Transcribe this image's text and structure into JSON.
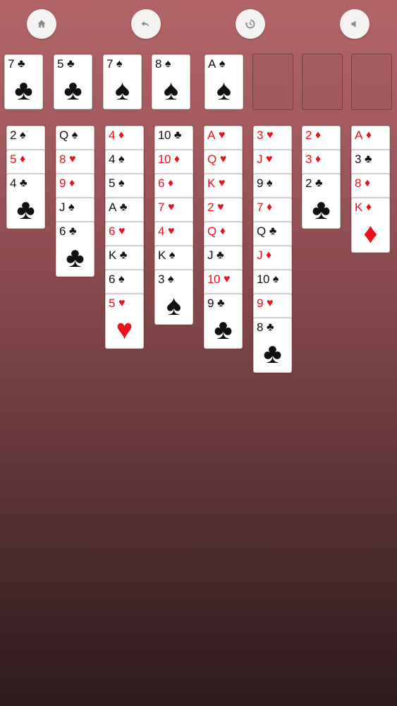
{
  "toolbar": {
    "buttons": [
      {
        "name": "home-button",
        "icon": "home-icon"
      },
      {
        "name": "undo-button",
        "icon": "undo-icon"
      },
      {
        "name": "restart-button",
        "icon": "restart-icon"
      },
      {
        "name": "sound-button",
        "icon": "speaker-icon"
      }
    ]
  },
  "colors": {
    "red_suit": "#e8111c",
    "black_suit": "#111111",
    "background_top": "#b26567",
    "background_bottom": "#2f1b1d"
  },
  "free_cells": [
    {
      "rank": "7",
      "suit": "♣"
    },
    {
      "rank": "5",
      "suit": "♣"
    },
    {
      "rank": "7",
      "suit": "♠"
    },
    {
      "rank": "8",
      "suit": "♠"
    }
  ],
  "foundations": [
    {
      "rank": "A",
      "suit": "♠"
    },
    null,
    null,
    null
  ],
  "tableau": [
    [
      {
        "rank": "2",
        "suit": "♠"
      },
      {
        "rank": "5",
        "suit": "♦"
      },
      {
        "rank": "4",
        "suit": "♣"
      }
    ],
    [
      {
        "rank": "Q",
        "suit": "♠"
      },
      {
        "rank": "8",
        "suit": "♥"
      },
      {
        "rank": "9",
        "suit": "♦"
      },
      {
        "rank": "J",
        "suit": "♠"
      },
      {
        "rank": "6",
        "suit": "♣"
      }
    ],
    [
      {
        "rank": "4",
        "suit": "♦"
      },
      {
        "rank": "4",
        "suit": "♠"
      },
      {
        "rank": "5",
        "suit": "♠"
      },
      {
        "rank": "A",
        "suit": "♣"
      },
      {
        "rank": "6",
        "suit": "♥"
      },
      {
        "rank": "K",
        "suit": "♣"
      },
      {
        "rank": "6",
        "suit": "♠"
      },
      {
        "rank": "5",
        "suit": "♥"
      }
    ],
    [
      {
        "rank": "10",
        "suit": "♣"
      },
      {
        "rank": "10",
        "suit": "♦"
      },
      {
        "rank": "6",
        "suit": "♦"
      },
      {
        "rank": "7",
        "suit": "♥"
      },
      {
        "rank": "4",
        "suit": "♥"
      },
      {
        "rank": "K",
        "suit": "♠"
      },
      {
        "rank": "3",
        "suit": "♠"
      }
    ],
    [
      {
        "rank": "A",
        "suit": "♥"
      },
      {
        "rank": "Q",
        "suit": "♥"
      },
      {
        "rank": "K",
        "suit": "♥"
      },
      {
        "rank": "2",
        "suit": "♥"
      },
      {
        "rank": "Q",
        "suit": "♦"
      },
      {
        "rank": "J",
        "suit": "♣"
      },
      {
        "rank": "10",
        "suit": "♥"
      },
      {
        "rank": "9",
        "suit": "♣"
      }
    ],
    [
      {
        "rank": "3",
        "suit": "♥"
      },
      {
        "rank": "J",
        "suit": "♥"
      },
      {
        "rank": "9",
        "suit": "♠"
      },
      {
        "rank": "7",
        "suit": "♦"
      },
      {
        "rank": "Q",
        "suit": "♣"
      },
      {
        "rank": "J",
        "suit": "♦"
      },
      {
        "rank": "10",
        "suit": "♠"
      },
      {
        "rank": "9",
        "suit": "♥"
      },
      {
        "rank": "8",
        "suit": "♣"
      }
    ],
    [
      {
        "rank": "2",
        "suit": "♦"
      },
      {
        "rank": "3",
        "suit": "♦"
      },
      {
        "rank": "2",
        "suit": "♣"
      }
    ],
    [
      {
        "rank": "A",
        "suit": "♦"
      },
      {
        "rank": "3",
        "suit": "♣"
      },
      {
        "rank": "8",
        "suit": "♦"
      },
      {
        "rank": "K",
        "suit": "♦"
      }
    ]
  ]
}
